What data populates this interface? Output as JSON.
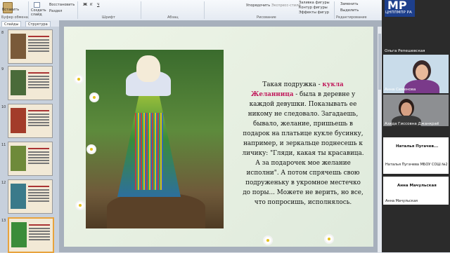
{
  "ribbon": {
    "paste": "Вставить",
    "clipboard": "Буфер обмена",
    "create_slide": "Создать слайд",
    "restore": "Восстановить",
    "section": "Раздел",
    "groups": {
      "font": "Шрифт",
      "paragraph": "Абзац",
      "drawing": "Рисование",
      "editing": "Редактирование"
    },
    "arrange": "Упорядочить",
    "quick_styles": "Экспресс-стили",
    "shape_fill": "Заливка фигуры",
    "shape_outline": "Контур фигуры",
    "shape_effects": "Эффекты фигур",
    "replace": "Заменить",
    "select": "Выделить"
  },
  "panel": {
    "tabs": [
      "Слайды",
      "Структура"
    ],
    "slide_numbers": [
      "8",
      "9",
      "10",
      "11",
      "12",
      "13"
    ],
    "selected": "13"
  },
  "slide": {
    "title_prefix": "Такая подружка - ",
    "doll_name": "кукла Желанница",
    "body": " - была в деревне у каждой девушки. Показывать ее никому не следовало. Загадаешь, бывало, желание, пришьешь в подарок на платьице кукле бусинку, например, и зеркальце поднесешь к личику: \"Гляди, какая ты красавица. А за подарочек мое желание исполни\". А потом спрячешь свою подруженьку в укромное местечко до поры... Можете не верить, но все, что попросишь, исполнялось."
  },
  "meeting": {
    "logo_text": "МР",
    "logo_sub": "ЦНППМПР РА",
    "participants": [
      {
        "top_label": "Ольга Репешевская",
        "bottom_label": "Анна Семенова"
      },
      {
        "top_label": "Азида Гиссовна Джанкраё"
      },
      {
        "top_label": "Наталья Пугачев...",
        "bottom_label": "Наталья Пугачева МБОУ СОШ №2"
      },
      {
        "top_label": "Анна Мачульская",
        "bottom_label": "Анна Мачульская"
      }
    ]
  }
}
